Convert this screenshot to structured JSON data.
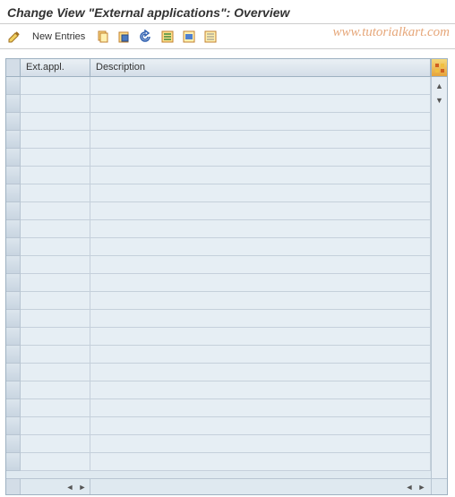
{
  "title": "Change View \"External applications\": Overview",
  "watermark": "www.tutorialkart.com",
  "toolbar": {
    "new_entries_label": "New Entries"
  },
  "grid": {
    "columns": {
      "ext_appl": "Ext.appl.",
      "description": "Description"
    },
    "rows": [
      {
        "ext": "",
        "desc": ""
      },
      {
        "ext": "",
        "desc": ""
      },
      {
        "ext": "",
        "desc": ""
      },
      {
        "ext": "",
        "desc": ""
      },
      {
        "ext": "",
        "desc": ""
      },
      {
        "ext": "",
        "desc": ""
      },
      {
        "ext": "",
        "desc": ""
      },
      {
        "ext": "",
        "desc": ""
      },
      {
        "ext": "",
        "desc": ""
      },
      {
        "ext": "",
        "desc": ""
      },
      {
        "ext": "",
        "desc": ""
      },
      {
        "ext": "",
        "desc": ""
      },
      {
        "ext": "",
        "desc": ""
      },
      {
        "ext": "",
        "desc": ""
      },
      {
        "ext": "",
        "desc": ""
      },
      {
        "ext": "",
        "desc": ""
      },
      {
        "ext": "",
        "desc": ""
      },
      {
        "ext": "",
        "desc": ""
      },
      {
        "ext": "",
        "desc": ""
      },
      {
        "ext": "",
        "desc": ""
      },
      {
        "ext": "",
        "desc": ""
      },
      {
        "ext": "",
        "desc": ""
      }
    ]
  }
}
